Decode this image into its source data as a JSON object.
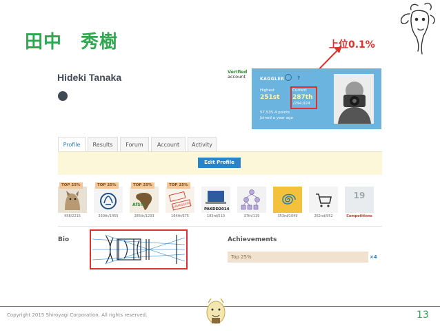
{
  "slide": {
    "title": "田中　秀樹",
    "rank_note": "上位0.1%",
    "copyright": "Copyright 2015 Shiroyagi Corporation. All rights reserved.",
    "page_number": "13"
  },
  "profile": {
    "name": "Hideki Tanaka",
    "verified_line1": "Verified",
    "verified_line2": "account"
  },
  "kaggler_card": {
    "label": "KAGGLER",
    "help": "?",
    "highest_label": "Highest",
    "highest_value": "251st",
    "current_label": "Current",
    "current_value": "287th",
    "current_total": "/294,924",
    "points": "57,535.4 points",
    "joined": "Joined a year ago"
  },
  "tabs": [
    "Profile",
    "Results",
    "Forum",
    "Account",
    "Activity"
  ],
  "edit_profile_label": "Edit Profile",
  "competitions": [
    {
      "badge": "TOP 25%",
      "count": "458/2215"
    },
    {
      "badge": "TOP 25%",
      "count": "330th/1455"
    },
    {
      "badge": "TOP 25%",
      "count": "285th/1233"
    },
    {
      "badge": "TOP 25%",
      "count": "164th/675",
      "stamp": "SUBMISSION"
    },
    {
      "badge": "",
      "count": "183rd/510",
      "label": "PAKDD2014"
    },
    {
      "badge": "",
      "count": "37th/119"
    },
    {
      "badge": "",
      "count": "353rd/1049"
    },
    {
      "badge": "",
      "count": "262nd/952"
    },
    {
      "badge": "",
      "count": "Competitions",
      "number": "19",
      "highlight": true
    }
  ],
  "sections": {
    "bio": "Bio",
    "achievements": "Achievements",
    "achievement_bar": "Top 25%",
    "achievement_multiplier": "×4"
  },
  "colors": {
    "accent_green": "#2fa84f",
    "highlight_red": "#e0302a",
    "card_blue": "#6ab4df",
    "link_blue": "#2a82c8"
  }
}
